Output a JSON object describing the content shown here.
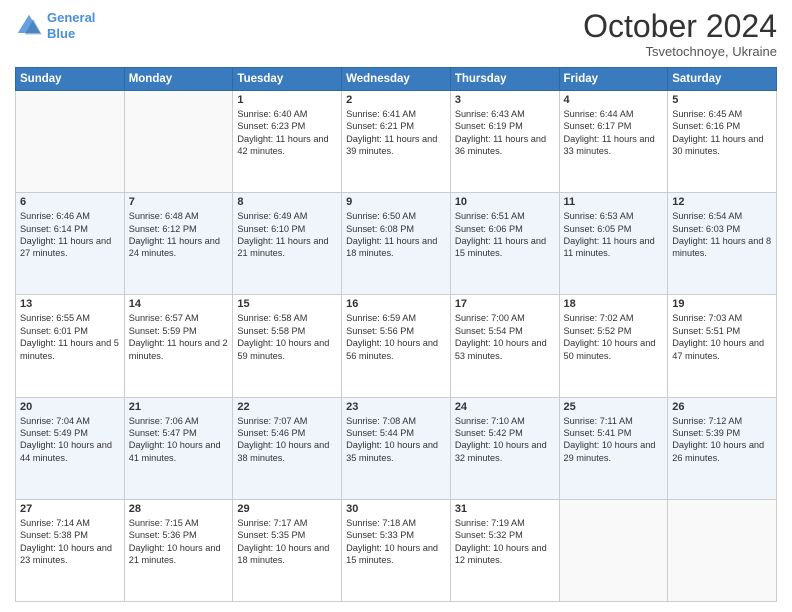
{
  "logo": {
    "line1": "General",
    "line2": "Blue"
  },
  "header": {
    "month": "October 2024",
    "location": "Tsvetochnoye, Ukraine"
  },
  "days_of_week": [
    "Sunday",
    "Monday",
    "Tuesday",
    "Wednesday",
    "Thursday",
    "Friday",
    "Saturday"
  ],
  "weeks": [
    [
      {
        "day": "",
        "sunrise": "",
        "sunset": "",
        "daylight": ""
      },
      {
        "day": "",
        "sunrise": "",
        "sunset": "",
        "daylight": ""
      },
      {
        "day": "1",
        "sunrise": "Sunrise: 6:40 AM",
        "sunset": "Sunset: 6:23 PM",
        "daylight": "Daylight: 11 hours and 42 minutes."
      },
      {
        "day": "2",
        "sunrise": "Sunrise: 6:41 AM",
        "sunset": "Sunset: 6:21 PM",
        "daylight": "Daylight: 11 hours and 39 minutes."
      },
      {
        "day": "3",
        "sunrise": "Sunrise: 6:43 AM",
        "sunset": "Sunset: 6:19 PM",
        "daylight": "Daylight: 11 hours and 36 minutes."
      },
      {
        "day": "4",
        "sunrise": "Sunrise: 6:44 AM",
        "sunset": "Sunset: 6:17 PM",
        "daylight": "Daylight: 11 hours and 33 minutes."
      },
      {
        "day": "5",
        "sunrise": "Sunrise: 6:45 AM",
        "sunset": "Sunset: 6:16 PM",
        "daylight": "Daylight: 11 hours and 30 minutes."
      }
    ],
    [
      {
        "day": "6",
        "sunrise": "Sunrise: 6:46 AM",
        "sunset": "Sunset: 6:14 PM",
        "daylight": "Daylight: 11 hours and 27 minutes."
      },
      {
        "day": "7",
        "sunrise": "Sunrise: 6:48 AM",
        "sunset": "Sunset: 6:12 PM",
        "daylight": "Daylight: 11 hours and 24 minutes."
      },
      {
        "day": "8",
        "sunrise": "Sunrise: 6:49 AM",
        "sunset": "Sunset: 6:10 PM",
        "daylight": "Daylight: 11 hours and 21 minutes."
      },
      {
        "day": "9",
        "sunrise": "Sunrise: 6:50 AM",
        "sunset": "Sunset: 6:08 PM",
        "daylight": "Daylight: 11 hours and 18 minutes."
      },
      {
        "day": "10",
        "sunrise": "Sunrise: 6:51 AM",
        "sunset": "Sunset: 6:06 PM",
        "daylight": "Daylight: 11 hours and 15 minutes."
      },
      {
        "day": "11",
        "sunrise": "Sunrise: 6:53 AM",
        "sunset": "Sunset: 6:05 PM",
        "daylight": "Daylight: 11 hours and 11 minutes."
      },
      {
        "day": "12",
        "sunrise": "Sunrise: 6:54 AM",
        "sunset": "Sunset: 6:03 PM",
        "daylight": "Daylight: 11 hours and 8 minutes."
      }
    ],
    [
      {
        "day": "13",
        "sunrise": "Sunrise: 6:55 AM",
        "sunset": "Sunset: 6:01 PM",
        "daylight": "Daylight: 11 hours and 5 minutes."
      },
      {
        "day": "14",
        "sunrise": "Sunrise: 6:57 AM",
        "sunset": "Sunset: 5:59 PM",
        "daylight": "Daylight: 11 hours and 2 minutes."
      },
      {
        "day": "15",
        "sunrise": "Sunrise: 6:58 AM",
        "sunset": "Sunset: 5:58 PM",
        "daylight": "Daylight: 10 hours and 59 minutes."
      },
      {
        "day": "16",
        "sunrise": "Sunrise: 6:59 AM",
        "sunset": "Sunset: 5:56 PM",
        "daylight": "Daylight: 10 hours and 56 minutes."
      },
      {
        "day": "17",
        "sunrise": "Sunrise: 7:00 AM",
        "sunset": "Sunset: 5:54 PM",
        "daylight": "Daylight: 10 hours and 53 minutes."
      },
      {
        "day": "18",
        "sunrise": "Sunrise: 7:02 AM",
        "sunset": "Sunset: 5:52 PM",
        "daylight": "Daylight: 10 hours and 50 minutes."
      },
      {
        "day": "19",
        "sunrise": "Sunrise: 7:03 AM",
        "sunset": "Sunset: 5:51 PM",
        "daylight": "Daylight: 10 hours and 47 minutes."
      }
    ],
    [
      {
        "day": "20",
        "sunrise": "Sunrise: 7:04 AM",
        "sunset": "Sunset: 5:49 PM",
        "daylight": "Daylight: 10 hours and 44 minutes."
      },
      {
        "day": "21",
        "sunrise": "Sunrise: 7:06 AM",
        "sunset": "Sunset: 5:47 PM",
        "daylight": "Daylight: 10 hours and 41 minutes."
      },
      {
        "day": "22",
        "sunrise": "Sunrise: 7:07 AM",
        "sunset": "Sunset: 5:46 PM",
        "daylight": "Daylight: 10 hours and 38 minutes."
      },
      {
        "day": "23",
        "sunrise": "Sunrise: 7:08 AM",
        "sunset": "Sunset: 5:44 PM",
        "daylight": "Daylight: 10 hours and 35 minutes."
      },
      {
        "day": "24",
        "sunrise": "Sunrise: 7:10 AM",
        "sunset": "Sunset: 5:42 PM",
        "daylight": "Daylight: 10 hours and 32 minutes."
      },
      {
        "day": "25",
        "sunrise": "Sunrise: 7:11 AM",
        "sunset": "Sunset: 5:41 PM",
        "daylight": "Daylight: 10 hours and 29 minutes."
      },
      {
        "day": "26",
        "sunrise": "Sunrise: 7:12 AM",
        "sunset": "Sunset: 5:39 PM",
        "daylight": "Daylight: 10 hours and 26 minutes."
      }
    ],
    [
      {
        "day": "27",
        "sunrise": "Sunrise: 7:14 AM",
        "sunset": "Sunset: 5:38 PM",
        "daylight": "Daylight: 10 hours and 23 minutes."
      },
      {
        "day": "28",
        "sunrise": "Sunrise: 7:15 AM",
        "sunset": "Sunset: 5:36 PM",
        "daylight": "Daylight: 10 hours and 21 minutes."
      },
      {
        "day": "29",
        "sunrise": "Sunrise: 7:17 AM",
        "sunset": "Sunset: 5:35 PM",
        "daylight": "Daylight: 10 hours and 18 minutes."
      },
      {
        "day": "30",
        "sunrise": "Sunrise: 7:18 AM",
        "sunset": "Sunset: 5:33 PM",
        "daylight": "Daylight: 10 hours and 15 minutes."
      },
      {
        "day": "31",
        "sunrise": "Sunrise: 7:19 AM",
        "sunset": "Sunset: 5:32 PM",
        "daylight": "Daylight: 10 hours and 12 minutes."
      },
      {
        "day": "",
        "sunrise": "",
        "sunset": "",
        "daylight": ""
      },
      {
        "day": "",
        "sunrise": "",
        "sunset": "",
        "daylight": ""
      }
    ]
  ]
}
